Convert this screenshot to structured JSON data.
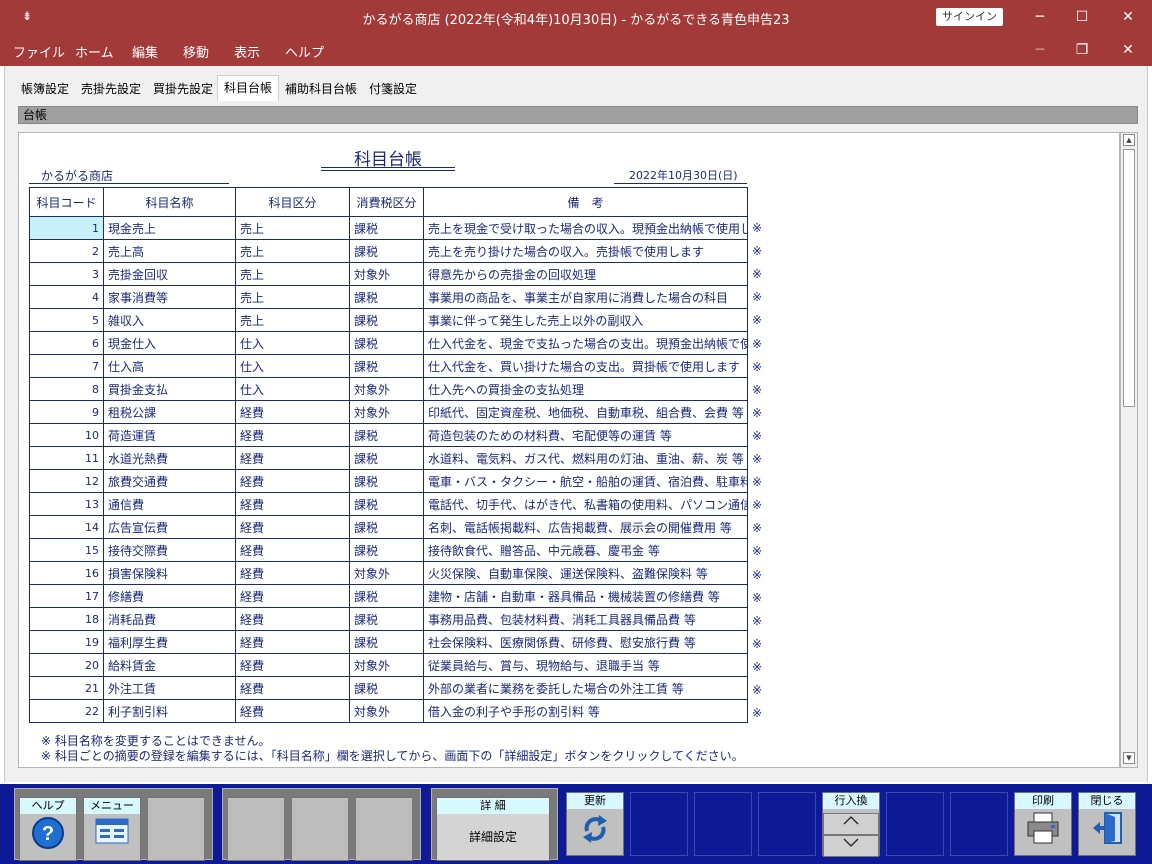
{
  "window": {
    "sysmenu": "⇟",
    "title": "かるがる商店 (2022年(令和4年)10月30日)  -  かるがるできる青色申告23",
    "signin": "サインイン",
    "minimize": "─",
    "maximize": "☐",
    "close": "✕"
  },
  "menu": {
    "items": [
      "ファイル",
      "ホーム",
      "編集",
      "移動",
      "表示",
      "ヘルプ"
    ],
    "inner_min": "─",
    "inner_restore": "❐",
    "inner_close": "✕"
  },
  "tabs": [
    "帳簿設定",
    "売掛先設定",
    "買掛先設定",
    "科目台帳",
    "補助科目台帳",
    "付箋設定"
  ],
  "active_tab": "科目台帳",
  "section_label": "台帳",
  "doc": {
    "title": "科目台帳",
    "company": "かるがる商店",
    "date": "2022年10月30日(日)"
  },
  "table": {
    "headers": [
      "科目コード",
      "科目名称",
      "科目区分",
      "消費税区分",
      "備　考"
    ],
    "rows": [
      {
        "code": "1",
        "name": "現金売上",
        "kubun": "売上",
        "tax": "課税",
        "note": "売上を現金で受け取った場合の収入。現預金出納帳で使用します"
      },
      {
        "code": "2",
        "name": "売上高",
        "kubun": "売上",
        "tax": "課税",
        "note": "売上を売り掛けた場合の収入。売掛帳で使用します"
      },
      {
        "code": "3",
        "name": "売掛金回収",
        "kubun": "売上",
        "tax": "対象外",
        "note": "得意先からの売掛金の回収処理"
      },
      {
        "code": "4",
        "name": "家事消費等",
        "kubun": "売上",
        "tax": "課税",
        "note": "事業用の商品を、事業主が自家用に消費した場合の科目"
      },
      {
        "code": "5",
        "name": "雑収入",
        "kubun": "売上",
        "tax": "課税",
        "note": "事業に伴って発生した売上以外の副収入"
      },
      {
        "code": "6",
        "name": "現金仕入",
        "kubun": "仕入",
        "tax": "課税",
        "note": "仕入代金を、現金で支払った場合の支出。現預金出納帳で使用します"
      },
      {
        "code": "7",
        "name": "仕入高",
        "kubun": "仕入",
        "tax": "課税",
        "note": "仕入代金を、買い掛けた場合の支出。買掛帳で使用します"
      },
      {
        "code": "8",
        "name": "買掛金支払",
        "kubun": "仕入",
        "tax": "対象外",
        "note": "仕入先への買掛金の支払処理"
      },
      {
        "code": "9",
        "name": "租税公課",
        "kubun": "経費",
        "tax": "対象外",
        "note": "印紙代、固定資産税、地価税、自動車税、組合費、会費 等"
      },
      {
        "code": "10",
        "name": "荷造運賃",
        "kubun": "経費",
        "tax": "課税",
        "note": "荷造包装のための材料費、宅配便等の運賃 等"
      },
      {
        "code": "11",
        "name": "水道光熱費",
        "kubun": "経費",
        "tax": "課税",
        "note": "水道料、電気料、ガス代、燃料用の灯油、重油、薪、炭 等"
      },
      {
        "code": "12",
        "name": "旅費交通費",
        "kubun": "経費",
        "tax": "課税",
        "note": "電車・バス・タクシー・航空・船舶の運賃、宿泊費、駐車料、通行料 等"
      },
      {
        "code": "13",
        "name": "通信費",
        "kubun": "経費",
        "tax": "課税",
        "note": "電話代、切手代、はがき代、私書箱の使用料、パソコン通信費 等"
      },
      {
        "code": "14",
        "name": "広告宣伝費",
        "kubun": "経費",
        "tax": "課税",
        "note": "名刺、電話帳掲載料、広告掲載費、展示会の開催費用 等"
      },
      {
        "code": "15",
        "name": "接待交際費",
        "kubun": "経費",
        "tax": "課税",
        "note": "接待飲食代、贈答品、中元歳暮、慶弔金 等"
      },
      {
        "code": "16",
        "name": "損害保険料",
        "kubun": "経費",
        "tax": "対象外",
        "note": "火災保険、自動車保険、運送保険料、盗難保険料 等"
      },
      {
        "code": "17",
        "name": "修繕費",
        "kubun": "経費",
        "tax": "課税",
        "note": "建物・店舗・自動車・器具備品・機械装置の修繕費 等"
      },
      {
        "code": "18",
        "name": "消耗品費",
        "kubun": "経費",
        "tax": "課税",
        "note": "事務用品費、包装材料費、消耗工具器具備品費 等"
      },
      {
        "code": "19",
        "name": "福利厚生費",
        "kubun": "経費",
        "tax": "課税",
        "note": "社会保険料、医療関係費、研修費、慰安旅行費 等"
      },
      {
        "code": "20",
        "name": "給料賃金",
        "kubun": "経費",
        "tax": "対象外",
        "note": "従業員給与、賞与、現物給与、退職手当 等"
      },
      {
        "code": "21",
        "name": "外注工賃",
        "kubun": "経費",
        "tax": "課税",
        "note": "外部の業者に業務を委託した場合の外注工賃 等"
      },
      {
        "code": "22",
        "name": "利子割引料",
        "kubun": "経費",
        "tax": "対象外",
        "note": "借入金の利子や手形の割引料 等"
      }
    ],
    "row_mark": "※"
  },
  "notes": [
    "※ 科目名称を変更することはできません。",
    "※ 科目ごとの摘要の登録を編集するには、「科目名称」欄を選択してから、画面下の「詳細設定」ボタンをクリックしてください。"
  ],
  "toolbar": {
    "help": "ヘルプ",
    "menu": "メニュー",
    "detail_label": "詳 細",
    "detail_button": "詳細設定",
    "refresh": "更新",
    "row_swap": "行入換",
    "print": "印刷",
    "close": "閉じる"
  },
  "colors": {
    "titlebar": "#a33a3a",
    "toolbar": "#0f1a96",
    "ink": "#1a2a78",
    "selection": "#c8f0f8"
  }
}
